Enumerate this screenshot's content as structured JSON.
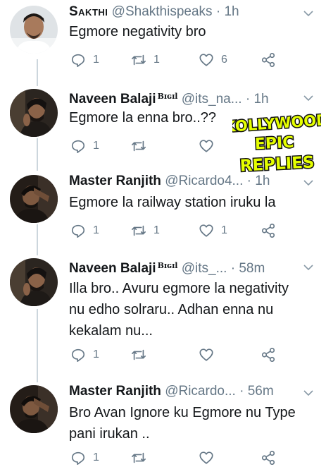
{
  "tweets": [
    {
      "name": "Sakthi",
      "badge": "",
      "handle": "@Shakthispeaks",
      "dot": "·",
      "time": "1h",
      "lines": [
        "Egmore negativity bro"
      ],
      "replies": "1",
      "retweets": "1",
      "likes": "6"
    },
    {
      "name": "Naveen Balaji",
      "badge": "Bɪɢɪl",
      "handle": "@its_na...",
      "dot": "·",
      "time": "1h",
      "lines": [
        "Egmore la enna bro..??"
      ],
      "replies": "1",
      "retweets": "",
      "likes": ""
    },
    {
      "name": "Master Ranjith",
      "badge": "",
      "handle": "@Ricardo4...",
      "dot": "·",
      "time": "1h",
      "lines": [
        "Egmore la railway station iruku la"
      ],
      "replies": "1",
      "retweets": "1",
      "likes": "1"
    },
    {
      "name": "Naveen Balaji",
      "badge": "Bɪɢɪl",
      "handle": "@its_...",
      "dot": "·",
      "time": "58m",
      "lines": [
        "Illa bro.. Avuru egmore la negativity",
        "nu edho solraru.. Adhan enna nu",
        "kekalam nu..."
      ],
      "replies": "1",
      "retweets": "",
      "likes": ""
    },
    {
      "name": "Master Ranjith",
      "badge": "",
      "handle": "@Ricardo...",
      "dot": "·",
      "time": "56m",
      "lines": [
        "Bro Avan Ignore ku Egmore nu Type",
        "pani irukan .."
      ],
      "replies": "1",
      "retweets": "",
      "likes": ""
    }
  ],
  "watermark": {
    "line1": "KOLLYWOOD",
    "line2": "EPIC",
    "line3": "REPLIES"
  },
  "icons": {
    "reply": "reply-icon",
    "retweet": "retweet-icon",
    "like": "heart-icon",
    "share": "share-icon",
    "menu": "chevron-down-icon"
  },
  "colors": {
    "text": "#14171a",
    "secondary": "#657786",
    "thread": "#ccd6dd",
    "watermark_fill": "#e5ff00"
  }
}
